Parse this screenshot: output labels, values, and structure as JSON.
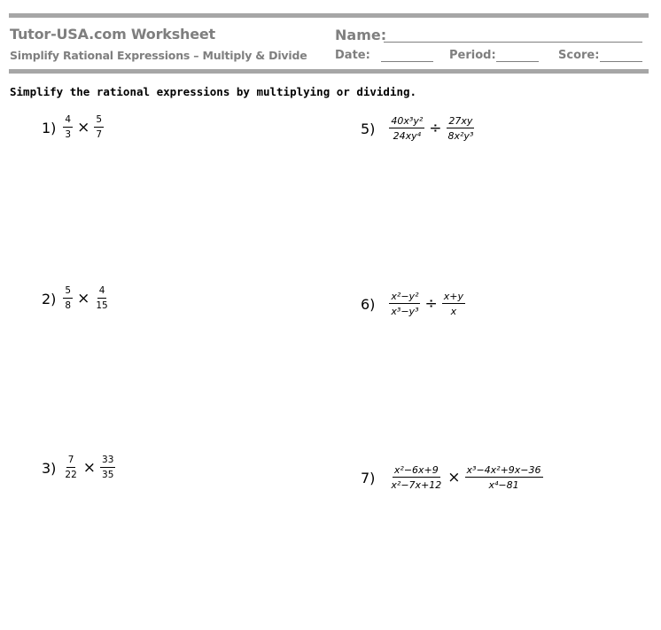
{
  "header": {
    "title": "Tutor-USA.com Worksheet",
    "subtitle": "Simplify Rational Expressions – Multiply & Divide",
    "name_label": "Name:",
    "date_label": "Date:",
    "period_label": "Period:",
    "score_label": "Score:"
  },
  "instructions": "Simplify the rational expressions by multiplying or dividing.",
  "problems": [
    {
      "number": "1)",
      "left": {
        "num": "4",
        "den": "3"
      },
      "operator": "×",
      "right": {
        "num": "5",
        "den": "7"
      }
    },
    {
      "number": "2)",
      "left": {
        "num": "5",
        "den": "8"
      },
      "operator": "×",
      "right": {
        "num": "4",
        "den": "15"
      }
    },
    {
      "number": "3)",
      "left": {
        "num": "7",
        "den": "22"
      },
      "operator": "×",
      "right": {
        "num": "33",
        "den": "35"
      }
    },
    {
      "number": "5)",
      "left": {
        "num": "40x³y²",
        "den": "24xy⁴"
      },
      "operator": "÷",
      "right": {
        "num": "27xy",
        "den": "8x²y³"
      }
    },
    {
      "number": "6)",
      "left": {
        "num": "x²−y²",
        "den": "x³−y³"
      },
      "operator": "÷",
      "right": {
        "num": "x+y",
        "den": "x"
      }
    },
    {
      "number": "7)",
      "left": {
        "num": "x²−6x+9",
        "den": "x²−7x+12"
      },
      "operator": "×",
      "right": {
        "num": "x³−4x²+9x−36",
        "den": "x⁴−81"
      }
    }
  ]
}
